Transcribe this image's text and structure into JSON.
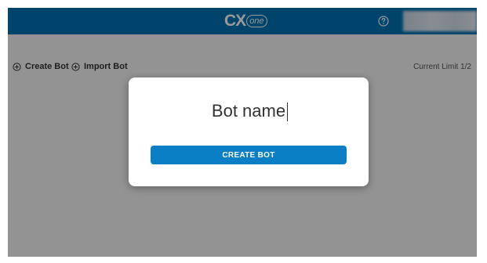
{
  "header": {
    "logo_main": "CX",
    "logo_sub": "one",
    "help_icon": "help-circle-icon",
    "user_avatar": "blurred-user-menu"
  },
  "toolbar": {
    "create_bot_label": "Create Bot",
    "create_bot_icon": "plus-circle-icon",
    "import_bot_label": "Import Bot",
    "import_bot_icon": "plus-circle-icon",
    "limit_text": "Current Limit 1/2"
  },
  "modal": {
    "input_value": "Bot name",
    "input_placeholder": "",
    "create_button_label": "CREATE BOT"
  },
  "colors": {
    "header_bg": "#0071b2",
    "button_bg": "#0a7fc5",
    "overlay": "rgba(0,0,0,0.40)"
  }
}
